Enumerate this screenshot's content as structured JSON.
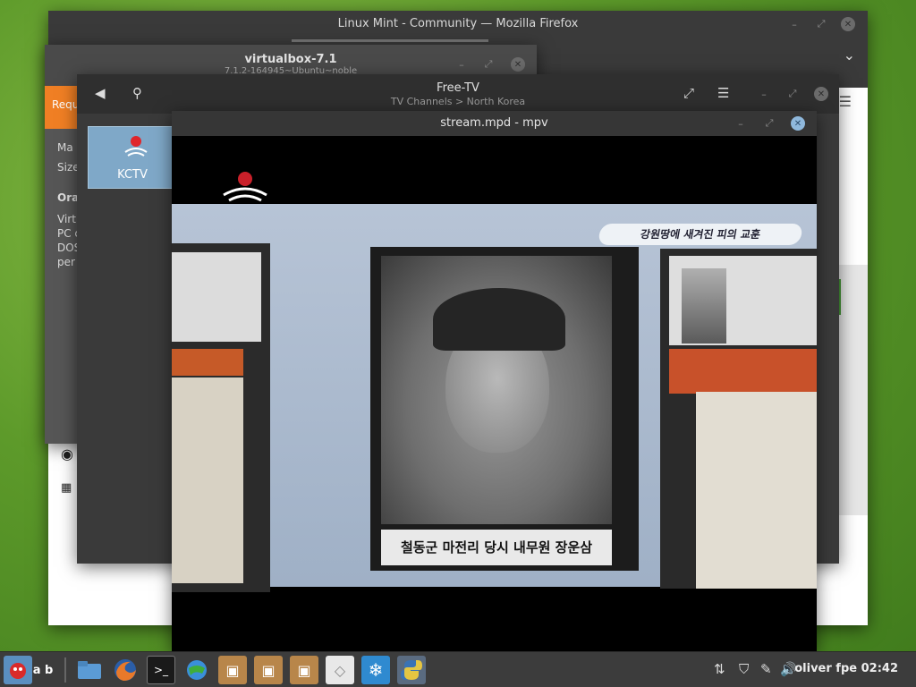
{
  "firefox": {
    "title": "Linux Mint - Community — Mozilla Firefox",
    "chevron": "⌄",
    "menu": "☰"
  },
  "virtualbox": {
    "title": "virtualbox-7.1",
    "subtitle": "7.1.2-164945~Ubuntu~noble",
    "tab": "Requ",
    "side_lines": [
      "Ma",
      "Size",
      "Ora",
      "Virt",
      "PC c",
      "DOS",
      "per"
    ]
  },
  "freetv": {
    "title": "Free-TV",
    "breadcrumb": "TV Channels > North Korea",
    "channels": [
      {
        "name": "KCTV"
      }
    ]
  },
  "mpv": {
    "title": "stream.mpd - mpv",
    "banner": "강원땅에 새겨진 피의 교훈",
    "caption": "철동군 마전리 당시 내무원 장운삼"
  },
  "taskbar": {
    "keyboard_label": "a b",
    "user_time": "oliver fpe 02:42"
  },
  "colors": {
    "desktop": "#5d9a2a",
    "taskbar": "#3c3c3c",
    "accent_orange": "#f07f24",
    "selected_channel": "#7fa8c8"
  }
}
